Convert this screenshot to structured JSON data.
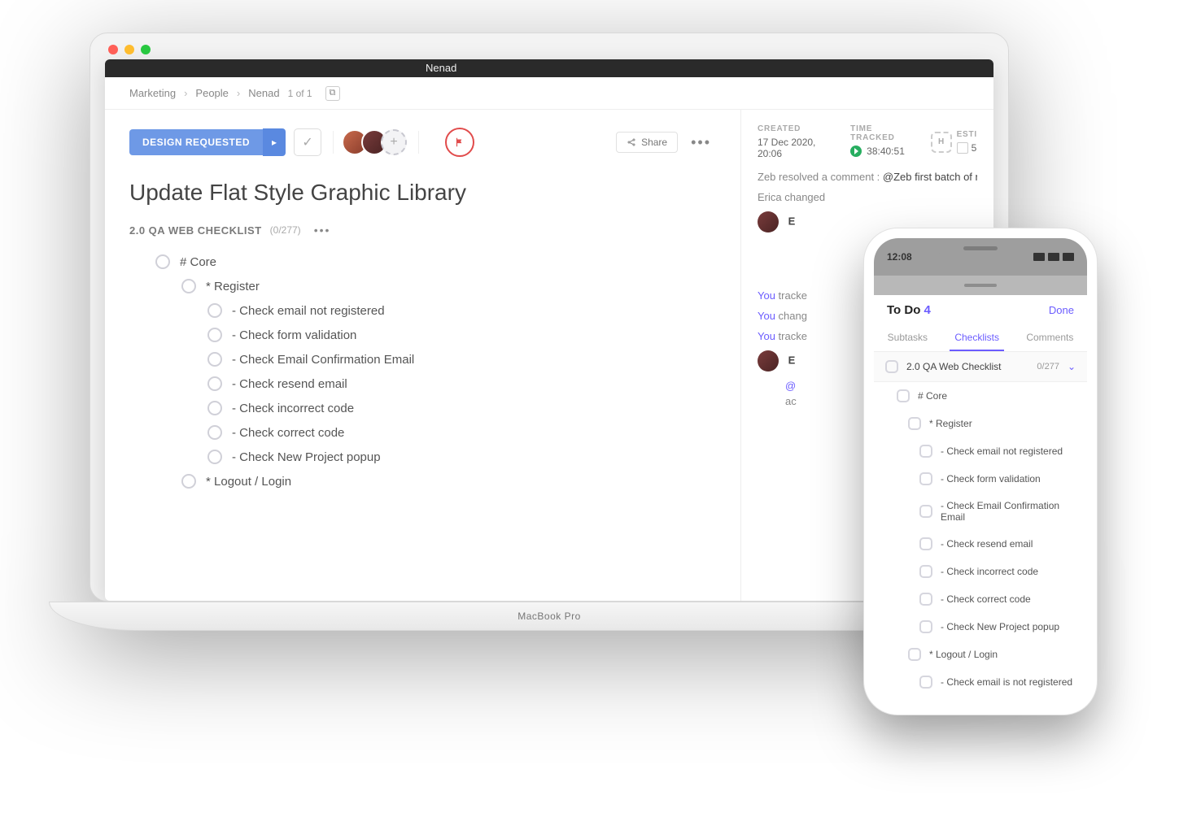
{
  "laptop": {
    "brand": "MacBook Pro",
    "window_tab": "Nenad"
  },
  "breadcrumb": {
    "items": [
      "Marketing",
      "People",
      "Nenad"
    ],
    "count": "1 of 1"
  },
  "toolbar": {
    "status_label": "DESIGN REQUESTED",
    "share_label": "Share",
    "flag_icon": "flag-icon",
    "add_icon": "plus-icon"
  },
  "task": {
    "title": "Update Flat Style Graphic Library"
  },
  "checklist": {
    "name": "2.0 QA WEB CHECKLIST",
    "count": "(0/277)",
    "items": [
      {
        "level": 1,
        "text": "# Core"
      },
      {
        "level": 2,
        "text": "* Register"
      },
      {
        "level": 3,
        "text": "- Check email not registered"
      },
      {
        "level": 3,
        "text": "- Check form validation"
      },
      {
        "level": 3,
        "text": "- Check Email Confirmation Email"
      },
      {
        "level": 3,
        "text": "- Check resend email"
      },
      {
        "level": 3,
        "text": "- Check incorrect code"
      },
      {
        "level": 3,
        "text": "- Check correct code"
      },
      {
        "level": 3,
        "text": "- Check New Project popup"
      },
      {
        "level": 2,
        "text": "* Logout / Login"
      }
    ]
  },
  "meta": {
    "created_label": "CREATED",
    "created_value": "17 Dec 2020, 20:06",
    "tracked_label": "TIME TRACKED",
    "tracked_value": "38:40:51",
    "estimate_label": "ESTI",
    "estimate_badge": "H",
    "estimate_value": "5"
  },
  "activity": {
    "l1_who": "Zeb",
    "l1_action": " resolved a comment : ",
    "l1_quote": "@Zeb first batch of n",
    "l2_who": "Erica",
    "l2_action": " changed",
    "l3_who": "E",
    "l4_you": "You",
    "l4_action": " tracke",
    "l5_you": "You",
    "l5_action": " chang",
    "l6_you": "You",
    "l6_action": " tracke",
    "l7_who": "E",
    "l7_at": "@",
    "l7_rest": "ac"
  },
  "phone": {
    "clock": "12:08",
    "title": "To Do",
    "title_count": "4",
    "done": "Done",
    "tabs": [
      "Subtasks",
      "Checklists",
      "Comments"
    ],
    "active_tab": 1,
    "list_head": "2.0 QA Web Checklist",
    "list_count": "0/277",
    "items": [
      {
        "level": 1,
        "text": "# Core"
      },
      {
        "level": 2,
        "text": "* Register"
      },
      {
        "level": 3,
        "text": "- Check email not registered"
      },
      {
        "level": 3,
        "text": "- Check form validation"
      },
      {
        "level": 3,
        "text": "- Check Email Confirmation Email"
      },
      {
        "level": 3,
        "text": "- Check resend email"
      },
      {
        "level": 3,
        "text": "- Check incorrect code"
      },
      {
        "level": 3,
        "text": "- Check correct code"
      },
      {
        "level": 3,
        "text": "- Check New Project popup"
      },
      {
        "level": 2,
        "text": "* Logout / Login"
      },
      {
        "level": 3,
        "text": "- Check email is not registered"
      }
    ]
  }
}
